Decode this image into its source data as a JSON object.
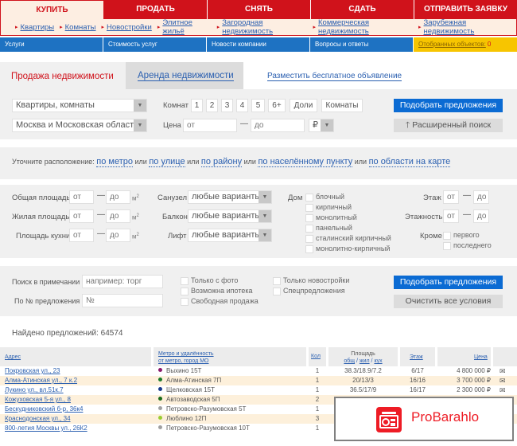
{
  "topnav": {
    "tabs": [
      "КУПИТЬ",
      "ПРОДАТЬ",
      "СНЯТЬ",
      "СДАТЬ",
      "ОТПРАВИТЬ ЗАЯВКУ"
    ],
    "active": "КУПИТЬ",
    "subnav": [
      "Квартиры",
      "Комнаты",
      "Новостройки",
      "Элитное жильё",
      "Загородная недвижимость",
      "Коммерческая недвижимость",
      "Зарубежная недвижимость"
    ]
  },
  "bluenav": {
    "items": [
      "Услуги",
      "Стоимость услуг",
      "Новости компании",
      "Вопросы и ответы"
    ],
    "favorites_label": "Отобранных объектов:",
    "favorites_count": "0"
  },
  "search_tabs": {
    "sale": "Продажа недвижимости",
    "rent": "Аренда недвижимости",
    "post_ad": "Разместить бесплатное объявление"
  },
  "filters": {
    "type_select": "Квартиры, комнаты",
    "region_select": "Москва и Московская область",
    "rooms_label": "Комнат",
    "rooms_options": [
      "1",
      "2",
      "3",
      "4",
      "5",
      "6+",
      "Доли",
      "Комнаты"
    ],
    "price_label": "Цена",
    "price_from_placeholder": "от",
    "price_to_placeholder": "до",
    "currency": "₽",
    "dash": "—",
    "search_button": "Подобрать предложения",
    "advanced_button": "Расширенный поиск",
    "advanced_icon": "arrow-up-icon"
  },
  "location": {
    "prefix": "Уточните расположение:",
    "or": "или",
    "links": [
      "по метро",
      "по улице",
      "по району",
      "по населённому пункту",
      "по области на карте"
    ]
  },
  "details": {
    "area_rows": [
      {
        "label": "Общая площадь",
        "from": "от",
        "to": "до",
        "unit": "м",
        "unit_exp": "2"
      },
      {
        "label": "Жилая площадь",
        "from": "от",
        "to": "до",
        "unit": "м",
        "unit_exp": "2"
      },
      {
        "label": "Площадь кухни",
        "from": "от",
        "to": "до",
        "unit": "м",
        "unit_exp": "2"
      }
    ],
    "selects": [
      {
        "label": "Санузел",
        "value": "любые варианты"
      },
      {
        "label": "Балкон",
        "value": "любые варианты"
      },
      {
        "label": "Лифт",
        "value": "любые варианты"
      }
    ],
    "house_label": "Дом",
    "house_types": [
      "блочный",
      "кирпичный",
      "монолитный",
      "панельный",
      "сталинский кирпичный",
      "монолитно-кирпичный"
    ],
    "floor_label": "Этаж",
    "floors_label": "Этажность",
    "from": "от",
    "to": "до",
    "except_label": "Кроме",
    "except_options": [
      "первого",
      "последнего"
    ]
  },
  "extra": {
    "note_label": "Поиск в примечании",
    "note_placeholder": "например: торг",
    "id_label": "По № предложения",
    "id_placeholder": "№",
    "checks_col1": [
      "Только с фото",
      "Возможна ипотека",
      "Свободная продажа"
    ],
    "checks_col2": [
      "Только новостройки",
      "Спецпредложения"
    ],
    "search_button": "Подобрать предложения",
    "clear_button": "Очистить все условия"
  },
  "results": {
    "found_label": "Найдено предложений: 64574",
    "headers": {
      "address": "Адрес",
      "metro_line1": "Метро и удалённость",
      "metro_line2": "от метро, город МО",
      "rooms": "Кол",
      "area_title": "Площадь",
      "area_parts": [
        "общ",
        "жил",
        "кух"
      ],
      "floor": "Этаж",
      "price": "Цена"
    },
    "rows": [
      {
        "address": "Покровская ул., 23",
        "metro": "Выхино 15Т",
        "metro_color": "#8b1a6b",
        "rooms": "1",
        "area": "38.3/18.9/7.2",
        "floor": "6/17",
        "price": "4 800 000 ₽"
      },
      {
        "address": "Алма-Атинская ул., 7 к.2",
        "metro": "Алма-Атинская 7П",
        "metro_color": "#1a7a2a",
        "rooms": "1",
        "area": "20/13/3",
        "floor": "16/16",
        "price": "3 700 000 ₽"
      },
      {
        "address": "Лукино ул., вл.51к.7",
        "metro": "Щелковская 15Т",
        "metro_color": "#1a3a8a",
        "rooms": "1",
        "area": "36.5/17/9",
        "floor": "16/17",
        "price": "2 300 000 ₽"
      },
      {
        "address": "Кожуховская 5-я ул., 8",
        "metro": "Автозаводская 5П",
        "metro_color": "#1a6a1a",
        "rooms": "2",
        "area": "",
        "floor": "",
        "price": ""
      },
      {
        "address": "Бескудниковский б-р, 36к4",
        "metro": "Петровско-Разумовская 5Т",
        "metro_color": "#a0a0a0",
        "rooms": "1",
        "area": "",
        "floor": "",
        "price": ""
      },
      {
        "address": "Краснодонская ул., 34",
        "metro": "Люблино 12П",
        "metro_color": "#9acd32",
        "rooms": "3",
        "area": "",
        "floor": "",
        "price": ""
      },
      {
        "address": "800-летия Москвы ул., 26К2",
        "metro": "Петровско-Разумовская 10Т",
        "metro_color": "#a0a0a0",
        "rooms": "1",
        "area": "",
        "floor": "",
        "price": ""
      }
    ]
  },
  "promo": {
    "name": "ProBarahlo",
    "color": "#ee1c25"
  }
}
